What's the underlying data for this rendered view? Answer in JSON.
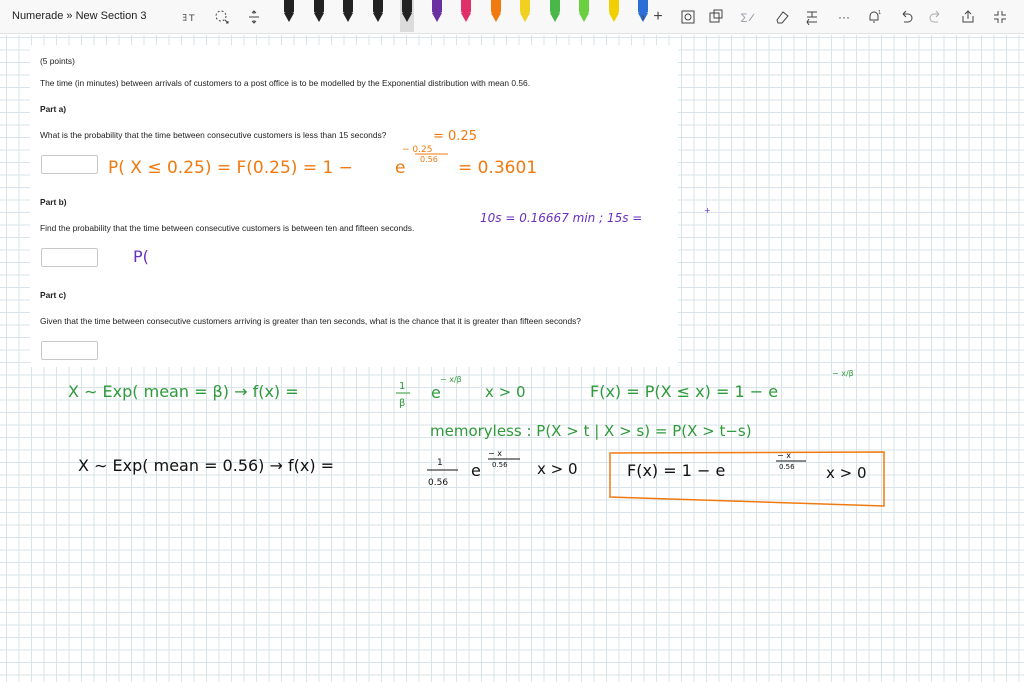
{
  "toolbar": {
    "breadcrumb": "Numerade » New Section 3",
    "pen_colors": [
      "#222222",
      "#222222",
      "#222222",
      "#222222",
      "#222222",
      "#6a2fa0",
      "#e0306a",
      "#f07a10",
      "#f0d020",
      "#49b848",
      "#6ad040",
      "#f0d000",
      "#2b6fd6"
    ],
    "selected_pen_index": 4,
    "more_glyph": "···"
  },
  "question": {
    "points": "(5 points)",
    "intro": "The time (in minutes) between arrivals of customers to a post office is to be modelled by the Exponential distribution with mean 0.56.",
    "part_a_label": "Part a)",
    "part_a_text": "What is the probability that the time between consecutive customers is less than 15 seconds?",
    "part_b_label": "Part b)",
    "part_b_text": "Find the probability that the time between consecutive customers is between ten and fifteen seconds.",
    "part_c_label": "Part c)",
    "part_c_text": "Given that the time between consecutive customers arriving is greater than ten seconds, what is the chance that it is greater than fifteen seconds?"
  },
  "handwriting": {
    "orange_a1": "= 0.25",
    "orange_a2": "P( X ≤ 0.25) = F(0.25) = 1 −",
    "orange_a_e": "e",
    "orange_a_exp_num": "− 0.25",
    "orange_a_exp_den": "0.56",
    "orange_a_result": "= 0.3601",
    "purple_b1": "10s = 0.16667 min ;  15s =",
    "purple_b2": "P(",
    "green_def": "X ∼ Exp( mean = β)  →   f(x) =",
    "green_frac_num": "1",
    "green_frac_den": "β",
    "green_e": "e",
    "green_exp": "− x/β",
    "green_cond": "x > 0",
    "green_cdf": "F(x) = P(X ≤ x) = 1 − e",
    "green_cdf_exp": "− x/β",
    "green_memory": "memoryless :   P(X > t | X > s) = P(X > t−s)",
    "black_def": "X ∼ Exp( mean = 0.56)  →   f(x) =",
    "black_frac_num": "1",
    "black_frac_den": "0.56",
    "black_e": "e",
    "black_exp_num": "− x",
    "black_exp_den": "0.56",
    "black_cond": "x > 0",
    "black_cdf": "F(x) =  1 −  e",
    "black_cdf_exp_num": "− x",
    "black_cdf_exp_den": "0.56",
    "black_cdf_cond": "x > 0"
  },
  "colors": {
    "orange": "#f07a10",
    "purple": "#6a2fc0",
    "green": "#2e9a3a",
    "black": "#111111",
    "box": "#f07a10"
  }
}
